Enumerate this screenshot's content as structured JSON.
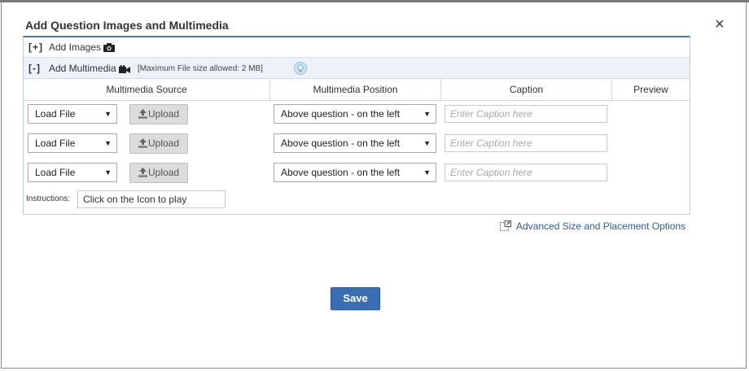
{
  "dialog": {
    "title": "Add Question Images and Multimedia",
    "close_label": "×"
  },
  "images_row": {
    "toggle": "[+]",
    "label": "Add Images",
    "icon": "camera-icon"
  },
  "multimedia_row": {
    "toggle": "[-]",
    "label": "Add Multimedia",
    "icon": "video-camera-icon",
    "max_size_note": "[Maximum File size allowed: 2 MB]",
    "help_icon": "lightbulb-icon"
  },
  "table": {
    "columns": [
      "Multimedia Source",
      "Multimedia Position",
      "Caption",
      "Preview"
    ],
    "rows": [
      {
        "source": "Load File",
        "upload": "Upload",
        "position": "Above question - on the left",
        "caption_placeholder": "Enter Caption here"
      },
      {
        "source": "Load File",
        "upload": "Upload",
        "position": "Above question - on the left",
        "caption_placeholder": "Enter Caption here"
      },
      {
        "source": "Load File",
        "upload": "Upload",
        "position": "Above question - on the left",
        "caption_placeholder": "Enter Caption here"
      }
    ]
  },
  "instructions": {
    "label": "Instructions:",
    "value": "Click on the Icon to play"
  },
  "advanced_link": "Advanced Size and Placement Options",
  "save_label": "Save",
  "colors": {
    "accent": "#3b6db3",
    "panel_border": "#4a7ab8",
    "link": "#2f5b8f"
  }
}
